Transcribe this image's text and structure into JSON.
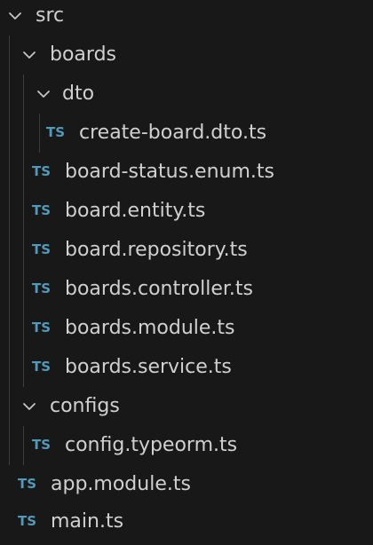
{
  "tree": {
    "src": {
      "label": "src",
      "expanded": true
    },
    "boards": {
      "label": "boards",
      "expanded": true
    },
    "dto": {
      "label": "dto",
      "expanded": true
    },
    "create_board_dto": {
      "label": "create-board.dto.ts",
      "icon": "TS"
    },
    "board_status_enum": {
      "label": "board-status.enum.ts",
      "icon": "TS"
    },
    "board_entity": {
      "label": "board.entity.ts",
      "icon": "TS"
    },
    "board_repository": {
      "label": "board.repository.ts",
      "icon": "TS"
    },
    "boards_controller": {
      "label": "boards.controller.ts",
      "icon": "TS"
    },
    "boards_module": {
      "label": "boards.module.ts",
      "icon": "TS"
    },
    "boards_service": {
      "label": "boards.service.ts",
      "icon": "TS"
    },
    "configs": {
      "label": "configs",
      "expanded": true
    },
    "config_typeorm": {
      "label": "config.typeorm.ts",
      "icon": "TS"
    },
    "app_module": {
      "label": "app.module.ts",
      "icon": "TS"
    },
    "main": {
      "label": "main.ts",
      "icon": "TS"
    }
  },
  "colors": {
    "background": "#181818",
    "text": "#d0d0d0",
    "ts_icon": "#519aba",
    "indent_guide": "#3c3c3c",
    "chevron": "#c5c5c5"
  }
}
